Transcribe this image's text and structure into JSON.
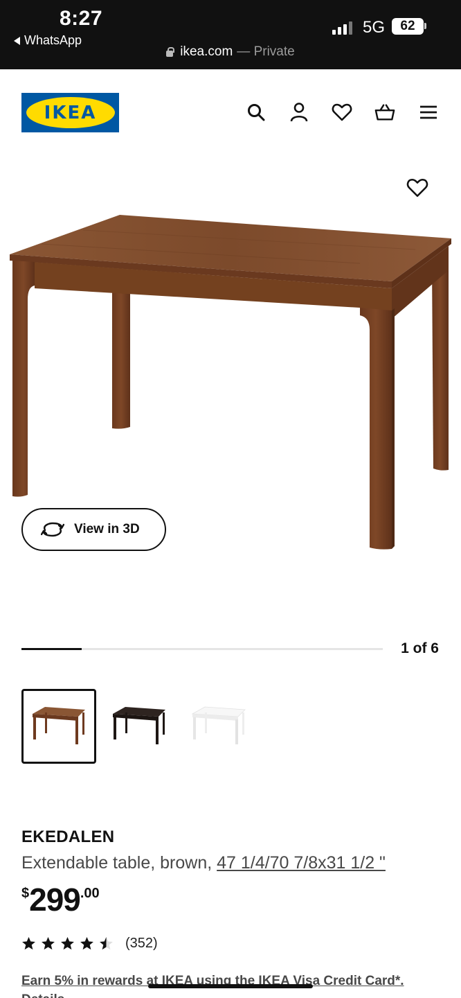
{
  "status_bar": {
    "time": "8:27",
    "back_app": "WhatsApp",
    "network": "5G",
    "battery": "62",
    "url": "ikea.com",
    "private_label": "— Private"
  },
  "header": {
    "logo_text": "IKEA",
    "icons": [
      "search-icon",
      "account-icon",
      "heart-icon",
      "basket-icon",
      "menu-icon"
    ]
  },
  "gallery": {
    "view_3d_label": "View in 3D",
    "counter": "1 of 6",
    "progress": 0.167,
    "thumbnails": [
      "brown",
      "black-brown",
      "white"
    ],
    "colors": {
      "brown": "#7a4527",
      "black": "#2a1f1b",
      "white": "#f2f2f2"
    }
  },
  "product": {
    "name": "EKEDALEN",
    "description_prefix": "Extendable table, brown,",
    "dimensions": "47 1/4/70 7/8x31 1/2 \"",
    "price_currency": "$",
    "price_main": "299",
    "price_decimal": ".00",
    "rating": 4.5,
    "rating_count": "(352)",
    "rewards_text": "Earn 5% in rewards at IKEA using the IKEA Visa Credit Card*.",
    "rewards_text_2": "Details"
  }
}
